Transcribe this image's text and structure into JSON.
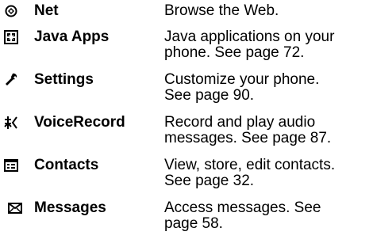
{
  "menu": [
    {
      "icon": "net-icon",
      "name": "Net",
      "desc": [
        "Browse the Web."
      ]
    },
    {
      "icon": "java-apps-icon",
      "name": "Java Apps",
      "desc": [
        "Java applications on your",
        "phone. See page 72."
      ]
    },
    {
      "icon": "wrench-icon",
      "name": "Settings",
      "desc": [
        "Customize your phone.",
        "See page 90."
      ]
    },
    {
      "icon": "voice-record-icon",
      "name": "VoiceRecord",
      "desc": [
        "Record and play audio",
        "messages. See page 87."
      ]
    },
    {
      "icon": "contacts-icon",
      "name": "Contacts",
      "desc": [
        "View, store, edit contacts.",
        "See page 32."
      ]
    },
    {
      "icon": "envelope-icon",
      "name": "Messages",
      "desc": [
        "Access messages. See",
        "page 58."
      ]
    }
  ]
}
